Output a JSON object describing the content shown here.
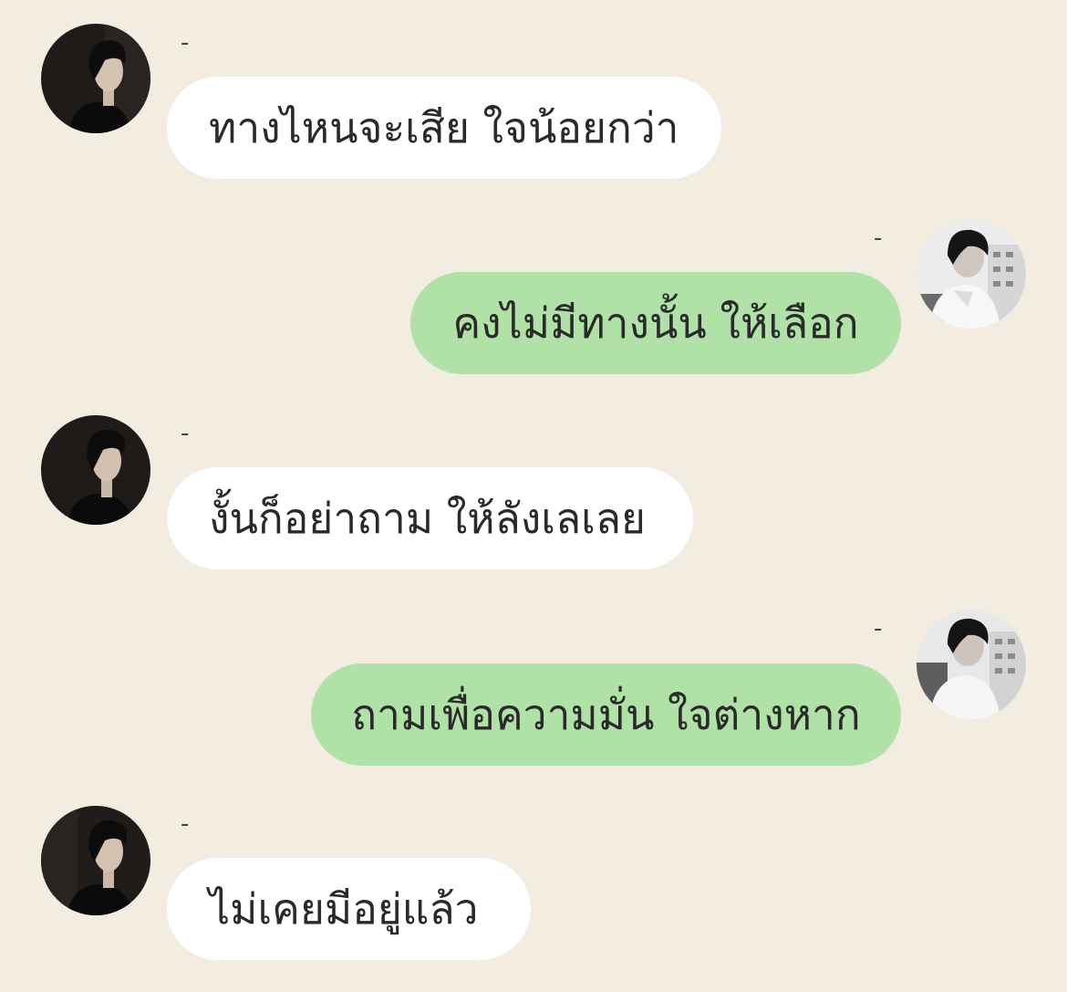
{
  "colors": {
    "background": "#f2ece1",
    "incoming_bubble": "#ffffff",
    "outgoing_bubble": "#b0e2a7",
    "text": "#2a2a2a"
  },
  "messages": [
    {
      "direction": "incoming",
      "sender": "-",
      "text": "ทางไหนจะเสีย ใจน้อยกว่า"
    },
    {
      "direction": "outgoing",
      "sender": "-",
      "text": "คงไม่มีทางนั้น ให้เลือก"
    },
    {
      "direction": "incoming",
      "sender": "-",
      "text": "งั้นก็อย่าถาม ให้ลังเลเลย"
    },
    {
      "direction": "outgoing",
      "sender": "-",
      "text": "ถามเพื่อความมั่น ใจต่างหาก"
    },
    {
      "direction": "incoming",
      "sender": "-",
      "text": "ไม่เคยมีอยู่แล้ว"
    }
  ]
}
